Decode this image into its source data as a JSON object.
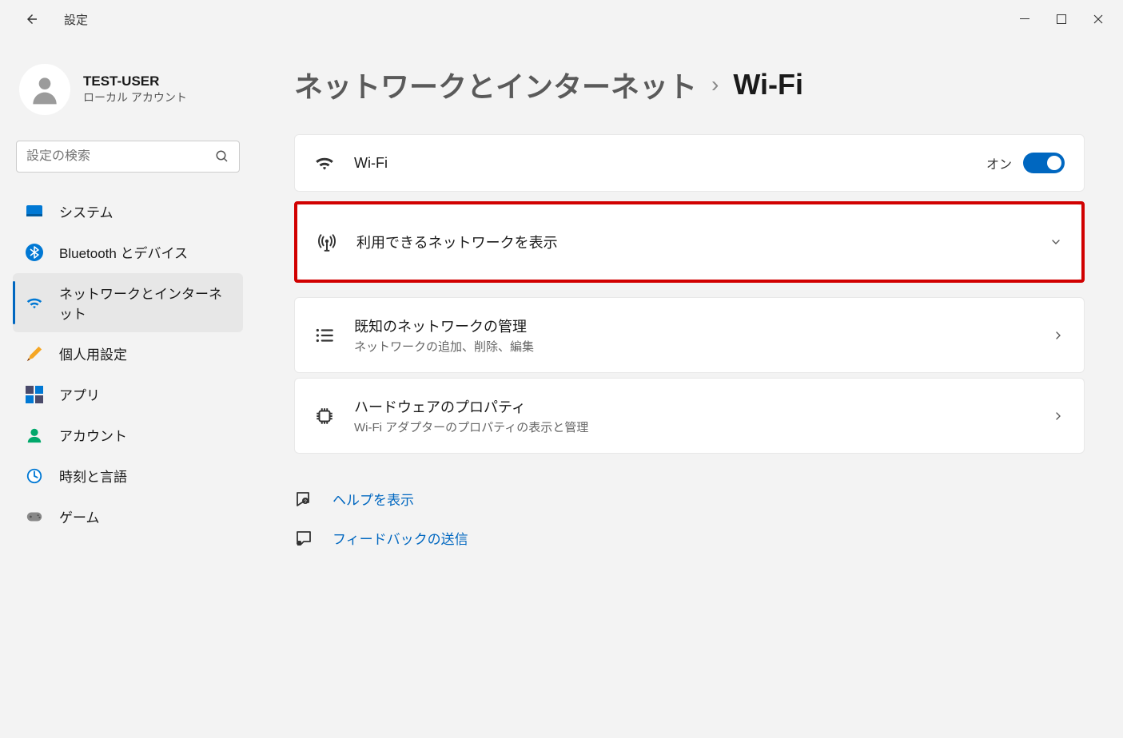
{
  "app": {
    "title": "設定"
  },
  "user": {
    "name": "TEST-USER",
    "type": "ローカル アカウント"
  },
  "search": {
    "placeholder": "設定の検索"
  },
  "nav": {
    "items": [
      {
        "label": "システム"
      },
      {
        "label": "Bluetooth とデバイス"
      },
      {
        "label": "ネットワークとインターネット"
      },
      {
        "label": "個人用設定"
      },
      {
        "label": "アプリ"
      },
      {
        "label": "アカウント"
      },
      {
        "label": "時刻と言語"
      },
      {
        "label": "ゲーム"
      }
    ]
  },
  "breadcrumb": {
    "parent": "ネットワークとインターネット",
    "sep": "›",
    "current": "Wi-Fi"
  },
  "wifi": {
    "title": "Wi-Fi",
    "state_label": "オン",
    "state": true
  },
  "available": {
    "title": "利用できるネットワークを表示"
  },
  "known": {
    "title": "既知のネットワークの管理",
    "sub": "ネットワークの追加、削除、編集"
  },
  "hardware": {
    "title": "ハードウェアのプロパティ",
    "sub": "Wi-Fi アダプターのプロパティの表示と管理"
  },
  "links": {
    "help": "ヘルプを表示",
    "feedback": "フィードバックの送信"
  }
}
